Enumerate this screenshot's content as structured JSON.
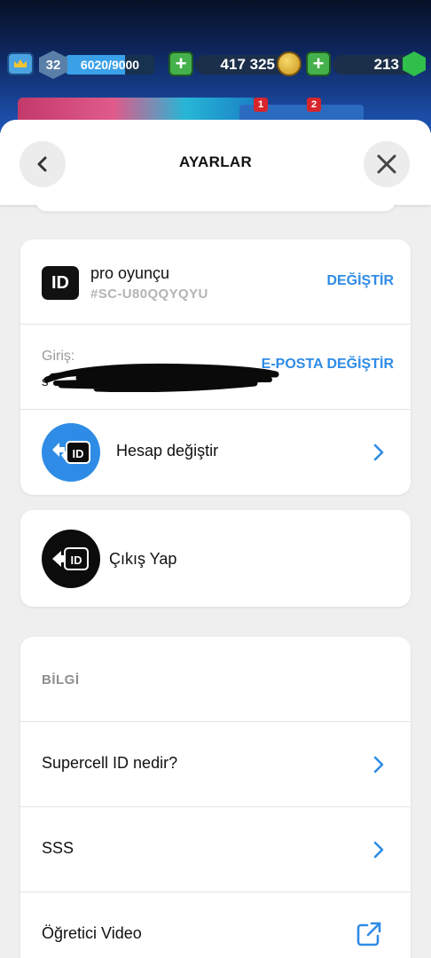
{
  "hud": {
    "level": "32",
    "xp": "6020/9000",
    "xp_fraction": 0.67,
    "gold": "417 325",
    "gems": "213",
    "notifications": [
      "1",
      "2"
    ]
  },
  "header": {
    "title": "AYARLAR"
  },
  "account": {
    "id_logo": "ID",
    "player_name": "pro oyunçu",
    "player_tag": "#SC-U80QQYQYU",
    "change_label": "DEĞİŞTİR",
    "login_label": "Giriş:",
    "login_value": "s",
    "email_change_label": "E-POSTA DEĞİŞTİR",
    "switch_account_label": "Hesap değiştir",
    "switch_icon_text": "ID"
  },
  "logout": {
    "label": "Çıkış Yap",
    "icon_text": "ID"
  },
  "info": {
    "section_title": "BİLGİ",
    "items": [
      {
        "label": "Supercell ID nedir?"
      },
      {
        "label": "SSS"
      },
      {
        "label": "Öğretici Video"
      }
    ]
  },
  "colors": {
    "accent_blue": "#2f8ce6",
    "background": "#efefef"
  }
}
